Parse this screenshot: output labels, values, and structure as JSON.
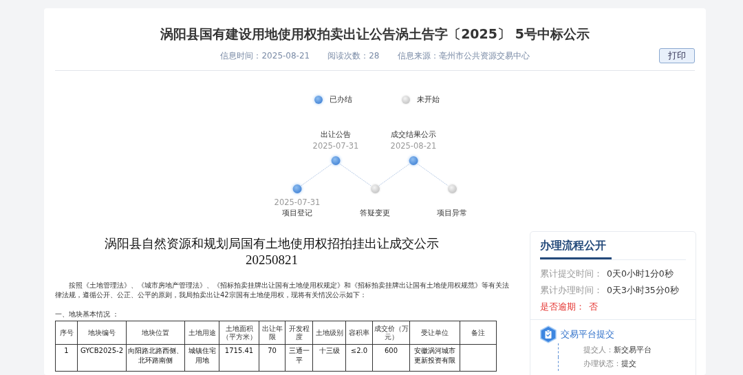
{
  "title": "涡阳县国有建设用地使用权拍卖出让公告涡土告字〔2025〕 5号中标公示",
  "meta": [
    {
      "label": "信息时间：",
      "value": "2025-08-21"
    },
    {
      "label": "阅读次数：",
      "value": "28"
    },
    {
      "label": "信息来源：",
      "value": "亳州市公共资源交易中心"
    }
  ],
  "print_button": "打印",
  "legend": [
    {
      "label": "已办结",
      "done": true
    },
    {
      "label": "未开始",
      "done": false
    }
  ],
  "steps": [
    {
      "label": "项目登记",
      "date": "2025-07-31",
      "done": true
    },
    {
      "label": "出让公告",
      "date": "2025-07-31",
      "done": true
    },
    {
      "label": "答疑变更",
      "done": false
    },
    {
      "label": "成交结果公示",
      "date": "2025-08-21",
      "done": true
    },
    {
      "label": "项目异常",
      "done": false
    }
  ],
  "document": {
    "title": "涡阳县自然资源和规划局国有土地使用权招拍挂出让成交公示",
    "date": "20250821",
    "intro": "按照《土地管理法》、《城市房地产管理法》、《招标拍卖挂牌出让国有土地使用权规定》和《招标拍卖挂牌出让国有土地使用权规范》等有关法律法规，遵循公开、公正、公平的原则，我局拍卖出让42宗国有土地使用权，现将有关情况公示如下：",
    "section_heading": "一、地块基本情况 ：",
    "table": {
      "columns": [
        "序号",
        "地块编号",
        "地块位置",
        "土地用途",
        "土地面积（平方米）",
        "出让年限",
        "开发程度",
        "土地级别",
        "容积率",
        "成交价（万元）",
        "受让单位",
        "备注"
      ],
      "rows": [
        [
          "1",
          "GYCB2025-2",
          "向阳路北路西侧、北环路南侧",
          "城镇住宅用地",
          "1715.41",
          "70",
          "三通一平",
          "十三级",
          "≤2.0",
          "600",
          "安徽涡河城市更新投资有限",
          ""
        ]
      ]
    }
  },
  "sidebar": {
    "title": "办理流程公开",
    "stats": [
      {
        "label": "累计提交时间：",
        "value": "0天0小时1分0秒",
        "kind": "normal"
      },
      {
        "label": "累计办理时间：",
        "value": "0天3小时35分0秒",
        "kind": "normal"
      },
      {
        "label": "是否逾期：",
        "value": "否",
        "kind": "alert"
      }
    ],
    "steps": [
      {
        "title": "交易平台提交",
        "fields": [
          {
            "label": "提交人：",
            "value": "新交易平台"
          },
          {
            "label": "办理状态：",
            "value": "提交"
          }
        ]
      }
    ]
  }
}
